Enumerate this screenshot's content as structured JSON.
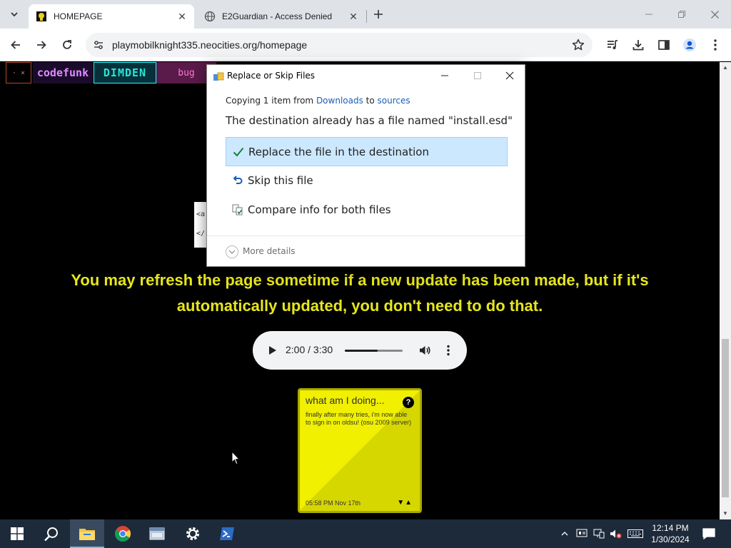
{
  "browser": {
    "tabs": [
      {
        "title": "HOMEPAGE",
        "active": true
      },
      {
        "title": "E2Guardian - Access Denied",
        "active": false
      }
    ],
    "url": "playmobilknight335.neocities.org/homepage"
  },
  "page": {
    "banners": [
      "· ×",
      "codefunk",
      "DIMDEN",
      "bug"
    ],
    "code_snippet": [
      "<a",
      "</"
    ],
    "headline_line1": "You may refresh the page sometime if a new update has been made, but if it's",
    "headline_line2": "automatically updated, you don't need to do that.",
    "audio": {
      "time": "2:00 / 3:30",
      "progress": 0.57
    },
    "note": {
      "title": "what am I doing...",
      "help": "?",
      "body": "finally after many tries, i'm now able to sign in on oldsu! (osu 2009 server)",
      "date": "05:58 PM Nov 17th",
      "arrows": "▼▲"
    }
  },
  "dialog": {
    "title": "Replace or Skip Files",
    "copy_prefix": "Copying 1 item from ",
    "copy_from": "Downloads",
    "copy_mid": " to ",
    "copy_to": "sources",
    "message": "The destination already has a file named \"install.esd\"",
    "options": [
      {
        "label": "Replace the file in the destination",
        "icon": "check-icon",
        "selected": true
      },
      {
        "label": "Skip this file",
        "icon": "skip-arrow-icon",
        "selected": false
      },
      {
        "label": "Compare info for both files",
        "icon": "compare-icon",
        "selected": false
      }
    ],
    "more_details": "More details"
  },
  "taskbar": {
    "time": "12:14 PM",
    "date": "1/30/2024"
  }
}
